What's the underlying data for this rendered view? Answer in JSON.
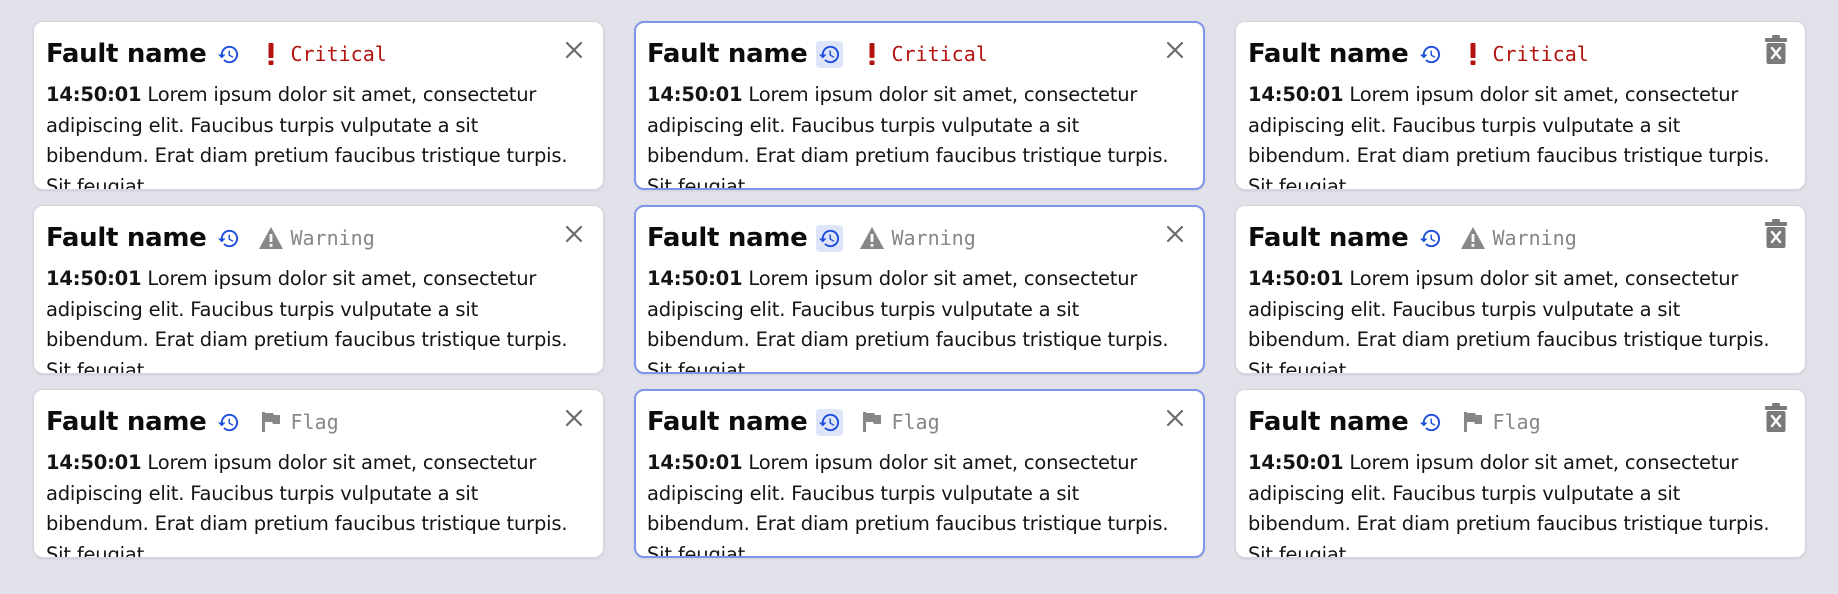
{
  "colors": {
    "critical": "#b3130f",
    "warning": "#878787",
    "flag": "#878787",
    "history_icon": "#1d4edb",
    "selected_border": "#7f95ec"
  },
  "cards": [
    {
      "title": "Fault name",
      "severity": "critical",
      "severity_label": "Critical",
      "time": "14:50:01",
      "text": " Lorem ipsum dolor sit amet, consectetur adipiscing elit. Faucibus turpis vulputate a sit bibendum. Erat diam pretium faucibus tristique turpis. Sit feugiat.",
      "action_icon": "close-icon"
    },
    {
      "title": "Fault name",
      "severity": "critical",
      "severity_label": "Critical",
      "time": "14:50:01",
      "text": " Lorem ipsum dolor sit amet, consectetur adipiscing elit. Faucibus turpis vulputate a sit bibendum. Erat diam pretium faucibus tristique turpis. Sit feugiat.",
      "action_icon": "close-icon"
    },
    {
      "title": "Fault name",
      "severity": "critical",
      "severity_label": "Critical",
      "time": "14:50:01",
      "text": " Lorem ipsum dolor sit amet, consectetur adipiscing elit. Faucibus turpis vulputate a sit bibendum. Erat diam pretium faucibus tristique turpis. Sit feugiat.",
      "action_icon": "trash-icon"
    },
    {
      "title": "Fault name",
      "severity": "warning",
      "severity_label": "Warning",
      "time": "14:50:01",
      "text": " Lorem ipsum dolor sit amet, consectetur adipiscing elit. Faucibus turpis vulputate a sit bibendum. Erat diam pretium faucibus tristique turpis. Sit feugiat.",
      "action_icon": "close-icon"
    },
    {
      "title": "Fault name",
      "severity": "warning",
      "severity_label": "Warning",
      "time": "14:50:01",
      "text": " Lorem ipsum dolor sit amet, consectetur adipiscing elit. Faucibus turpis vulputate a sit bibendum. Erat diam pretium faucibus tristique turpis. Sit feugiat.",
      "action_icon": "close-icon"
    },
    {
      "title": "Fault name",
      "severity": "warning",
      "severity_label": "Warning",
      "time": "14:50:01",
      "text": " Lorem ipsum dolor sit amet, consectetur adipiscing elit. Faucibus turpis vulputate a sit bibendum. Erat diam pretium faucibus tristique turpis. Sit feugiat.",
      "action_icon": "trash-icon"
    },
    {
      "title": "Fault name",
      "severity": "flag",
      "severity_label": "Flag",
      "time": "14:50:01",
      "text": " Lorem ipsum dolor sit amet, consectetur adipiscing elit. Faucibus turpis vulputate a sit bibendum. Erat diam pretium faucibus tristique turpis. Sit feugiat.",
      "action_icon": "close-icon"
    },
    {
      "title": "Fault name",
      "severity": "flag",
      "severity_label": "Flag",
      "time": "14:50:01",
      "text": " Lorem ipsum dolor sit amet, consectetur adipiscing elit. Faucibus turpis vulputate a sit bibendum. Erat diam pretium faucibus tristique turpis. Sit feugiat.",
      "action_icon": "close-icon"
    },
    {
      "title": "Fault name",
      "severity": "flag",
      "severity_label": "Flag",
      "time": "14:50:01",
      "text": " Lorem ipsum dolor sit amet, consectetur adipiscing elit. Faucibus turpis vulputate a sit bibendum. Erat diam pretium faucibus tristique turpis. Sit feugiat.",
      "action_icon": "trash-icon"
    }
  ]
}
